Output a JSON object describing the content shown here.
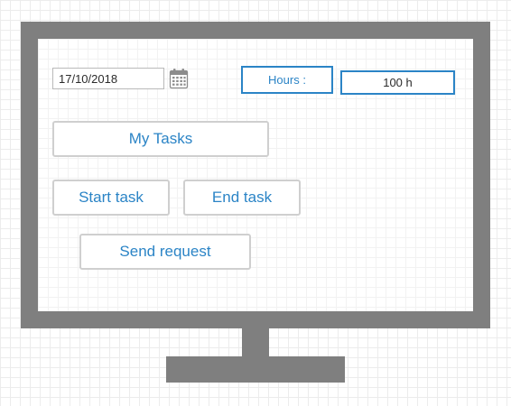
{
  "form": {
    "date_value": "17/10/2018",
    "calendar_icon": "calendar-icon",
    "hours_label": "Hours :",
    "hours_value": "100 h"
  },
  "buttons": {
    "my_tasks": "My Tasks",
    "start_task": "Start task",
    "end_task": "End task",
    "send_request": "Send request"
  },
  "colors": {
    "accent": "#2b84c6",
    "monitor": "#7f7f7f",
    "button_border": "#cfcfcf",
    "field_border": "#b9b9b9"
  }
}
